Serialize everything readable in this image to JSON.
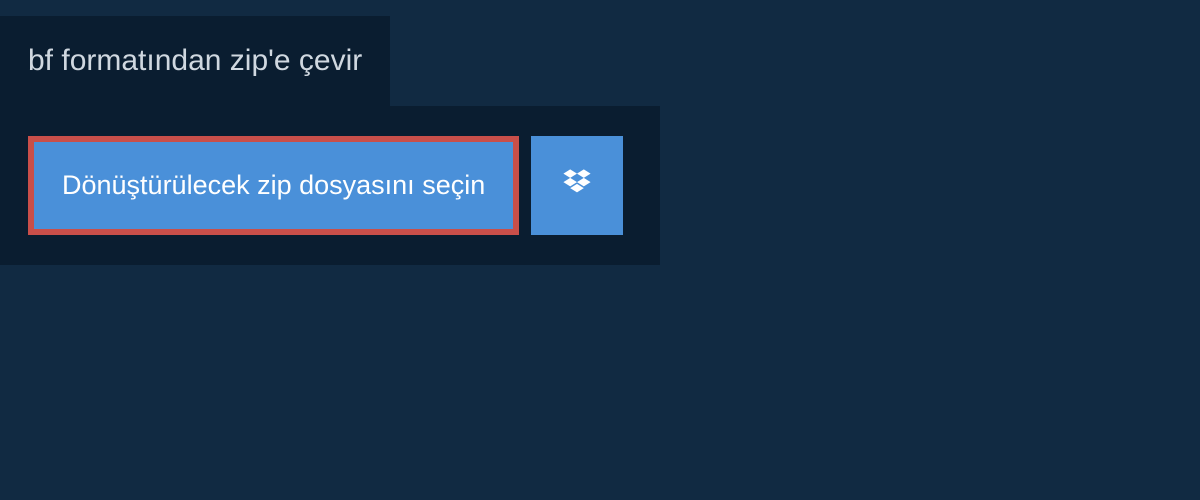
{
  "header": {
    "title": "bf formatından zip'e çevir"
  },
  "main": {
    "select_file_label": "Dönüştürülecek zip dosyasını seçin"
  },
  "colors": {
    "page_bg": "#112a42",
    "panel_bg": "#0a1d30",
    "button_bg": "#4a90d9",
    "button_border": "#c94f4a",
    "text_light": "#ffffff",
    "text_muted": "#d0d8e0"
  }
}
